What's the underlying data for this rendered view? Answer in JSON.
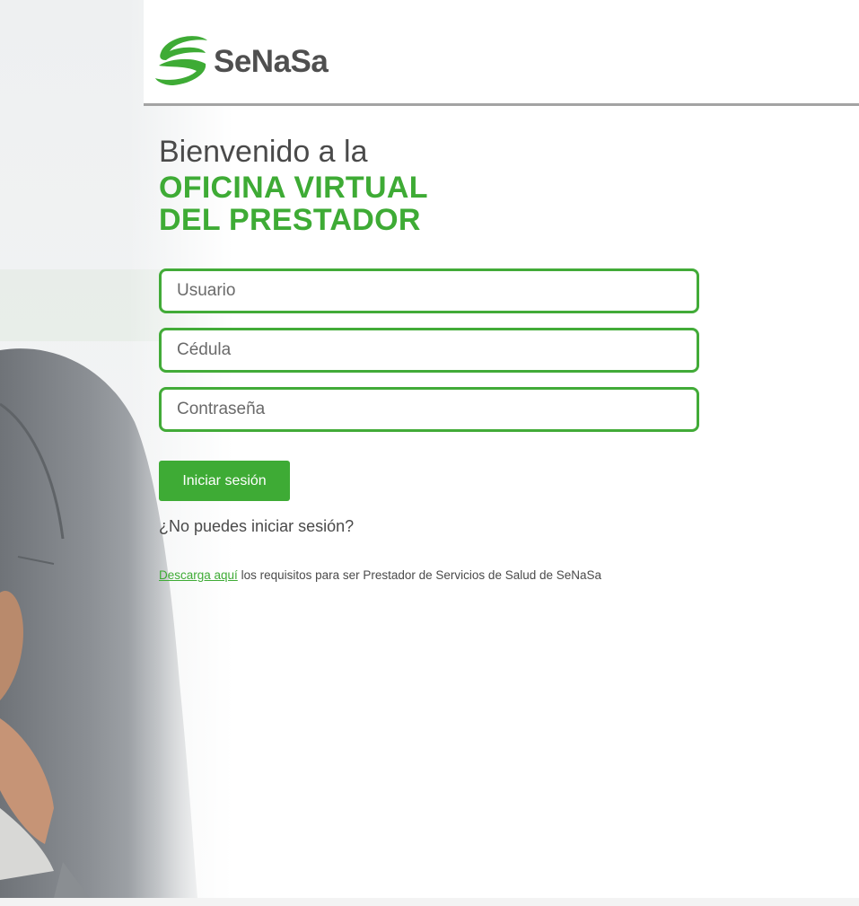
{
  "brand": {
    "name": "SeNaSa",
    "logo_icon": "senasa-swoosh-icon",
    "accent_color": "#3eab35",
    "text_color": "#4f4f4f"
  },
  "welcome": {
    "line1": "Bienvenido a la",
    "line2": "OFICINA VIRTUAL",
    "line3": "DEL PRESTADOR"
  },
  "form": {
    "usuario_placeholder": "Usuario",
    "cedula_placeholder": "Cédula",
    "password_placeholder": "Contraseña",
    "usuario_value": "",
    "cedula_value": "",
    "password_value": "",
    "submit_label": "Iniciar sesión",
    "forgot_label": "¿No puedes iniciar sesión?"
  },
  "download": {
    "link_label": "Descarga aquí",
    "rest_text": " los requisitos para ser Prestador de Servicios de Salud de SeNaSa"
  }
}
